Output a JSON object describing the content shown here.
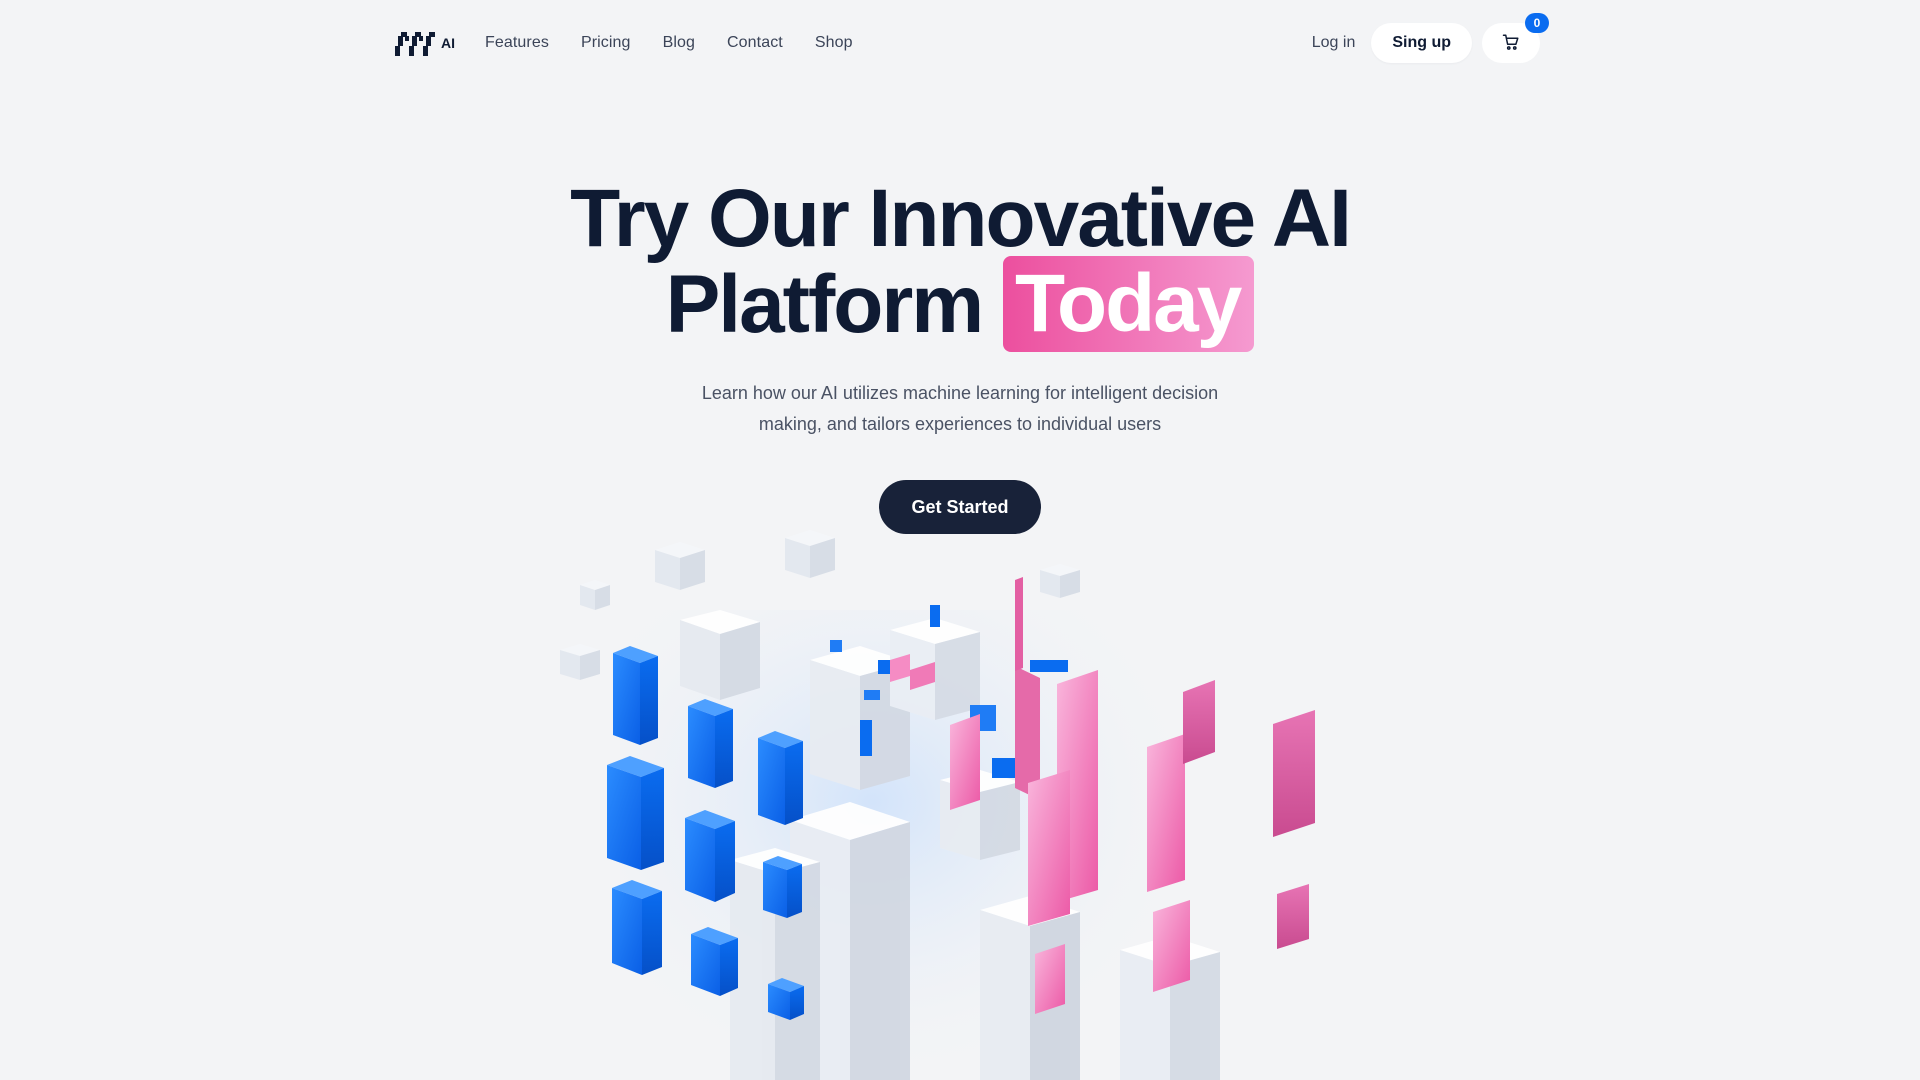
{
  "brand": {
    "text": "AI",
    "logo_icon": "pixel-logo-icon"
  },
  "nav": {
    "items": [
      {
        "label": "Features"
      },
      {
        "label": "Pricing"
      },
      {
        "label": "Blog"
      },
      {
        "label": "Contact"
      },
      {
        "label": "Shop"
      }
    ]
  },
  "auth": {
    "login_label": "Log in",
    "signup_label": "Sing up"
  },
  "cart": {
    "icon": "cart-icon",
    "count": "0"
  },
  "hero": {
    "title_line1": "Try Our Innovative AI",
    "title_line2": "Platform",
    "title_highlight": "Today",
    "subtitle_line1": "Learn how our AI utilizes machine learning for intelligent decision",
    "subtitle_line2": "making, and tailors experiences to individual users",
    "cta_label": "Get Started"
  },
  "colors": {
    "accent_blue": "#0a6cf0",
    "accent_pink": "#ec4f9e",
    "dark": "#182239",
    "background": "#f3f4f6"
  }
}
